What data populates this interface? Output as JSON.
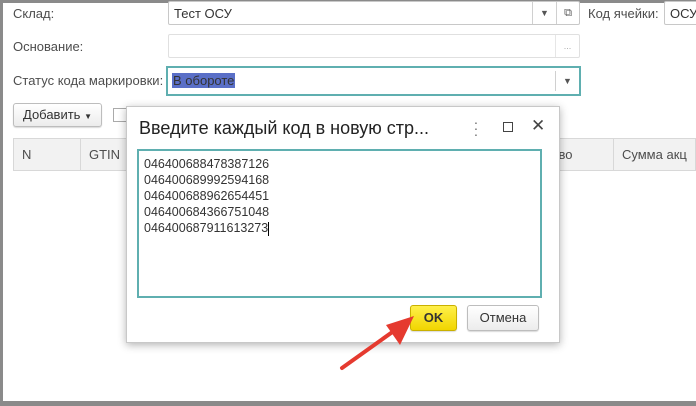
{
  "form": {
    "warehouse_label": "Склад:",
    "warehouse_value": "Тест ОСУ",
    "cell_code_label": "Код ячейки:",
    "cell_code_value": "ОСУ",
    "basis_label": "Основание:",
    "basis_value": "",
    "ellipsis": "...",
    "status_label": "Статус кода маркировки:",
    "status_value": "В обороте",
    "add_button": "Добавить"
  },
  "table": {
    "columns": [
      "N",
      "GTIN",
      "ство",
      "Сумма акц"
    ]
  },
  "dialog": {
    "title": "Введите каждый код в новую стр...",
    "codes": [
      "046400688478387126",
      "046400689992594168",
      "046400688962654451",
      "046400684366751048",
      "046400687911613273"
    ],
    "ok_label": "OK",
    "cancel_label": "Отмена"
  },
  "colors": {
    "accent": "#5fafb0",
    "ok": "#f5dc1a",
    "arrow": "#e53a2f",
    "selection": "#5a6fc7"
  }
}
